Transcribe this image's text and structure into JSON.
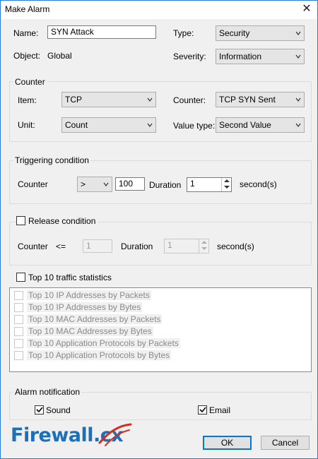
{
  "window": {
    "title": "Make Alarm"
  },
  "general": {
    "name_label": "Name:",
    "name_value": "SYN Attack",
    "object_label": "Object:",
    "object_value": "Global",
    "type_label": "Type:",
    "type_value": "Security",
    "severity_label": "Severity:",
    "severity_value": "Information"
  },
  "counter_group": {
    "title": "Counter",
    "item_label": "Item:",
    "item_value": "TCP",
    "unit_label": "Unit:",
    "unit_value": "Count",
    "counter_label": "Counter:",
    "counter_value": "TCP SYN Sent",
    "value_type_label": "Value type:",
    "value_type_value": "Second Value"
  },
  "triggering": {
    "title": "Triggering condition",
    "counter_label": "Counter",
    "operator_value": ">",
    "threshold_value": "100",
    "duration_label": "Duration",
    "duration_value": "1",
    "unit_label": "second(s)"
  },
  "release": {
    "title": "Release condition",
    "checked": false,
    "counter_label": "Counter",
    "operator_text": "<=",
    "threshold_value": "1",
    "duration_label": "Duration",
    "duration_value": "1",
    "unit_label": "second(s)"
  },
  "top10": {
    "title": "Top 10 traffic statistics",
    "checked": false,
    "items": [
      "Top 10 IP Addresses by Packets",
      "Top 10 IP Addresses by Bytes",
      "Top 10 MAC Addresses by Packets",
      "Top 10 MAC Addresses by Bytes",
      "Top 10 Application Protocols by Packets",
      "Top 10 Application Protocols by Bytes"
    ]
  },
  "notification": {
    "title": "Alarm notification",
    "sound_label": "Sound",
    "sound_checked": true,
    "email_label": "Email",
    "email_checked": true
  },
  "buttons": {
    "ok": "OK",
    "cancel": "Cancel"
  },
  "watermark": {
    "text": "Firewall.cx"
  },
  "icons": [
    "close-icon",
    "chevron-down-icon",
    "checkmark-icon",
    "spin-up-icon",
    "spin-down-icon"
  ],
  "colors": {
    "accent": "#0078d7",
    "window_border": "#2b79d6",
    "logo_blue": "#1d6fb8",
    "logo_red": "#d62d20"
  }
}
